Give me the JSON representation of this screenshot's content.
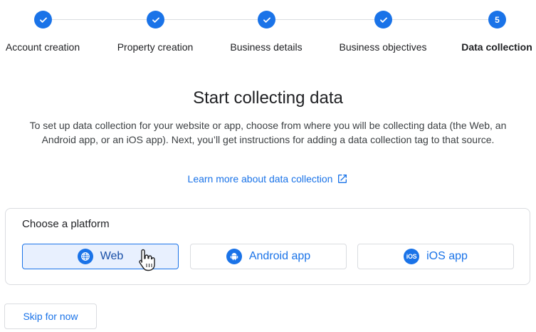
{
  "stepper": {
    "steps": [
      {
        "label": "Account creation",
        "state": "completed"
      },
      {
        "label": "Property creation",
        "state": "completed"
      },
      {
        "label": "Business details",
        "state": "completed"
      },
      {
        "label": "Business objectives",
        "state": "completed"
      },
      {
        "label": "Data collection",
        "state": "active",
        "number": "5"
      }
    ]
  },
  "main": {
    "title": "Start collecting data",
    "description": "To set up data collection for your website or app, choose from where you will be collecting data (the Web, an Android app, or an iOS app). Next, you’ll get instructions for adding a data collection tag to that source.",
    "learn_more_link": "Learn more about data collection"
  },
  "platform": {
    "title": "Choose a platform",
    "options": [
      {
        "label": "Web",
        "icon": "globe-icon",
        "selected": true
      },
      {
        "label": "Android app",
        "icon": "android-icon",
        "selected": false
      },
      {
        "label": "iOS app",
        "icon": "ios-icon",
        "icon_text": "iOS",
        "selected": false
      }
    ]
  },
  "footer": {
    "skip_label": "Skip for now"
  },
  "colors": {
    "accent": "#1a73e8",
    "selected_bg": "#e8f0fe",
    "border": "#dadce0"
  }
}
